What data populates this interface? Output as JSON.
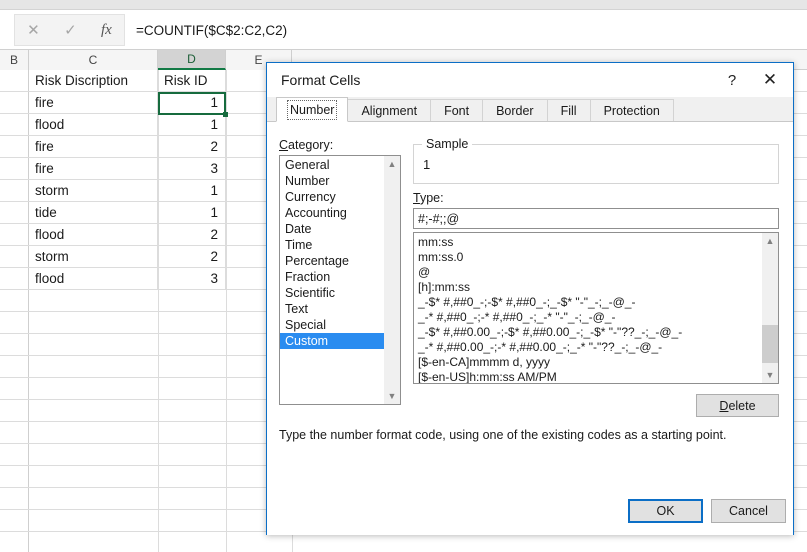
{
  "formula_bar": {
    "cancel_icon": "cancel-x-icon",
    "enter_icon": "enter-check-icon",
    "function_icon": "fx",
    "formula": "=COUNTIF($C$2:C2,C2)"
  },
  "sheet": {
    "columns": [
      {
        "label": "B",
        "selected": false
      },
      {
        "label": "C",
        "selected": false
      },
      {
        "label": "D",
        "selected": true
      },
      {
        "label": "E",
        "selected": false
      }
    ],
    "headers": {
      "c": "Risk Discription",
      "d": "Risk ID"
    },
    "rows": [
      {
        "c": "fire",
        "d": "1"
      },
      {
        "c": "flood",
        "d": "1"
      },
      {
        "c": "fire",
        "d": "2"
      },
      {
        "c": "fire",
        "d": "3"
      },
      {
        "c": "storm",
        "d": "1"
      },
      {
        "c": "tide",
        "d": "1"
      },
      {
        "c": "flood",
        "d": "2"
      },
      {
        "c": "storm",
        "d": "2"
      },
      {
        "c": "flood",
        "d": "3"
      }
    ],
    "active_cell_value": "1"
  },
  "dialog": {
    "title": "Format Cells",
    "help_icon": "?",
    "close_icon": "✕",
    "tabs": [
      {
        "label": "Number",
        "active": true
      },
      {
        "label": "Alignment",
        "active": false
      },
      {
        "label": "Font",
        "active": false
      },
      {
        "label": "Border",
        "active": false
      },
      {
        "label": "Fill",
        "active": false
      },
      {
        "label": "Protection",
        "active": false
      }
    ],
    "category_label": "Category:",
    "category_accel": "C",
    "categories": [
      {
        "label": "General",
        "selected": false
      },
      {
        "label": "Number",
        "selected": false
      },
      {
        "label": "Currency",
        "selected": false
      },
      {
        "label": "Accounting",
        "selected": false
      },
      {
        "label": "Date",
        "selected": false
      },
      {
        "label": "Time",
        "selected": false
      },
      {
        "label": "Percentage",
        "selected": false
      },
      {
        "label": "Fraction",
        "selected": false
      },
      {
        "label": "Scientific",
        "selected": false
      },
      {
        "label": "Text",
        "selected": false
      },
      {
        "label": "Special",
        "selected": false
      },
      {
        "label": "Custom",
        "selected": true
      }
    ],
    "sample_label": "Sample",
    "sample_value": "1",
    "type_label": "Type:",
    "type_accel": "T",
    "type_value": "#;-#;;@",
    "types": [
      {
        "label": "mm:ss",
        "selected": false
      },
      {
        "label": "mm:ss.0",
        "selected": false
      },
      {
        "label": "@",
        "selected": false
      },
      {
        "label": "[h]:mm:ss",
        "selected": false
      },
      {
        "label": "_-$* #,##0_-;-$* #,##0_-;_-$* \"-\"_-;_-@_-",
        "selected": false
      },
      {
        "label": "_-* #,##0_-;-* #,##0_-;_-* \"-\"_-;_-@_-",
        "selected": false
      },
      {
        "label": "_-$* #,##0.00_-;-$* #,##0.00_-;_-$* \"-\"??_-;_-@_-",
        "selected": false
      },
      {
        "label": "_-* #,##0.00_-;-* #,##0.00_-;_-* \"-\"??_-;_-@_-",
        "selected": false
      },
      {
        "label": "[$-en-CA]mmmm d, yyyy",
        "selected": false
      },
      {
        "label": "[$-en-US]h:mm:ss AM/PM",
        "selected": false
      },
      {
        "label": "#;-#;;@",
        "selected": true
      }
    ],
    "delete_label": "Delete",
    "delete_accel": "D",
    "help_text": "Type the number format code, using one of the existing codes as a starting point.",
    "ok_label": "OK",
    "cancel_label": "Cancel"
  },
  "colors": {
    "accent_blue": "#0b6ec6",
    "selection_blue": "#2a8cf0",
    "excel_green": "#166b3e"
  }
}
